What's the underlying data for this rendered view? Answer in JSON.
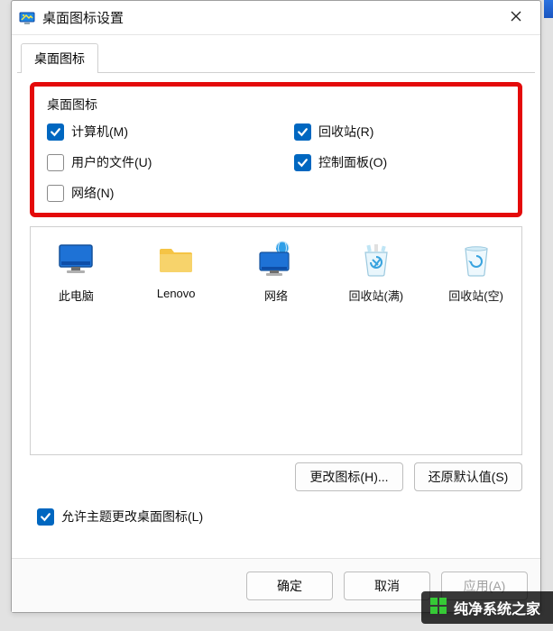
{
  "window": {
    "title": "桌面图标设置"
  },
  "tab": {
    "label": "桌面图标"
  },
  "group": {
    "label": "桌面图标"
  },
  "checks": {
    "computer": {
      "label": "计算机(M)",
      "checked": true
    },
    "recycle": {
      "label": "回收站(R)",
      "checked": true
    },
    "userfiles": {
      "label": "用户的文件(U)",
      "checked": false
    },
    "controlpanel": {
      "label": "控制面板(O)",
      "checked": true
    },
    "network": {
      "label": "网络(N)",
      "checked": false
    }
  },
  "preview": {
    "thispc": "此电脑",
    "lenovo": "Lenovo",
    "network": "网络",
    "recyclefull": "回收站(满)",
    "recycleempty": "回收站(空)"
  },
  "buttons": {
    "changeicon": "更改图标(H)...",
    "restore": "还原默认值(S)",
    "ok": "确定",
    "cancel": "取消",
    "apply": "应用(A)"
  },
  "theme": {
    "label": "允许主题更改桌面图标(L)",
    "checked": true
  },
  "watermark": "纯净系统之家"
}
